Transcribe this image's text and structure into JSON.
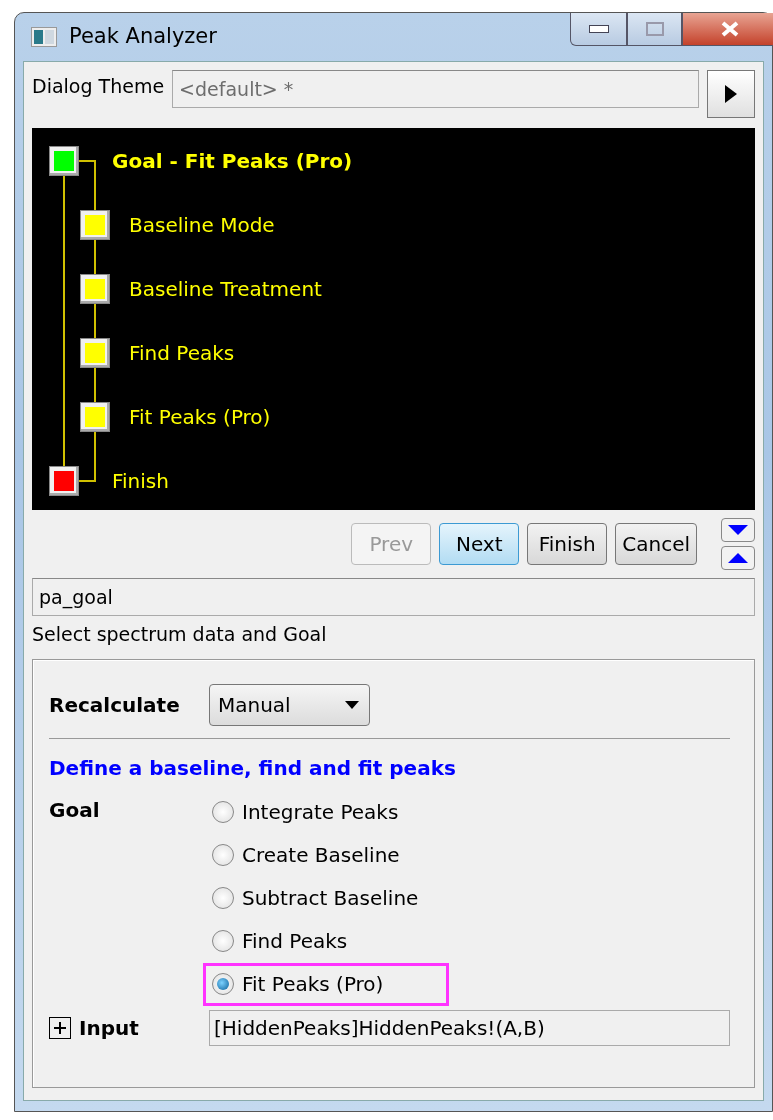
{
  "window": {
    "title": "Peak Analyzer"
  },
  "dialog_theme": {
    "label": "Dialog Theme",
    "value": "<default> *"
  },
  "tree": [
    {
      "label": "Goal - Fit Peaks (Pro)",
      "color": "#00ff00",
      "current": true,
      "children": [
        {
          "label": "Baseline Mode",
          "color": "#ffff00",
          "current": false
        },
        {
          "label": "Baseline Treatment",
          "color": "#ffff00",
          "current": false
        },
        {
          "label": "Find Peaks",
          "color": "#ffff00",
          "current": false
        },
        {
          "label": "Fit Peaks (Pro)",
          "color": "#ffff00",
          "current": false
        }
      ]
    },
    {
      "label": "Finish",
      "color": "#ff0000",
      "current": false
    }
  ],
  "nav_buttons": [
    {
      "label": "Prev",
      "disabled": true,
      "default": false
    },
    {
      "label": "Next",
      "disabled": false,
      "default": true
    },
    {
      "label": "Finish",
      "disabled": false,
      "default": false
    },
    {
      "label": "Cancel",
      "disabled": false,
      "default": false
    }
  ],
  "page_name": "pa_goal",
  "description": "Select spectrum data and Goal",
  "recalculate": {
    "label": "Recalculate",
    "value": "Manual"
  },
  "section_title": "Define a baseline, find and fit peaks",
  "goal": {
    "label": "Goal",
    "options": [
      {
        "label": "Integrate Peaks",
        "selected": false,
        "highlighted": false
      },
      {
        "label": "Create Baseline",
        "selected": false,
        "highlighted": false
      },
      {
        "label": "Subtract Baseline",
        "selected": false,
        "highlighted": false
      },
      {
        "label": "Find Peaks",
        "selected": false,
        "highlighted": false
      },
      {
        "label": "Fit Peaks (Pro)",
        "selected": true,
        "highlighted": true
      }
    ]
  },
  "input": {
    "label": "Input",
    "expanded": false,
    "value": "[HiddenPeaks]HiddenPeaks!(A,B)"
  }
}
